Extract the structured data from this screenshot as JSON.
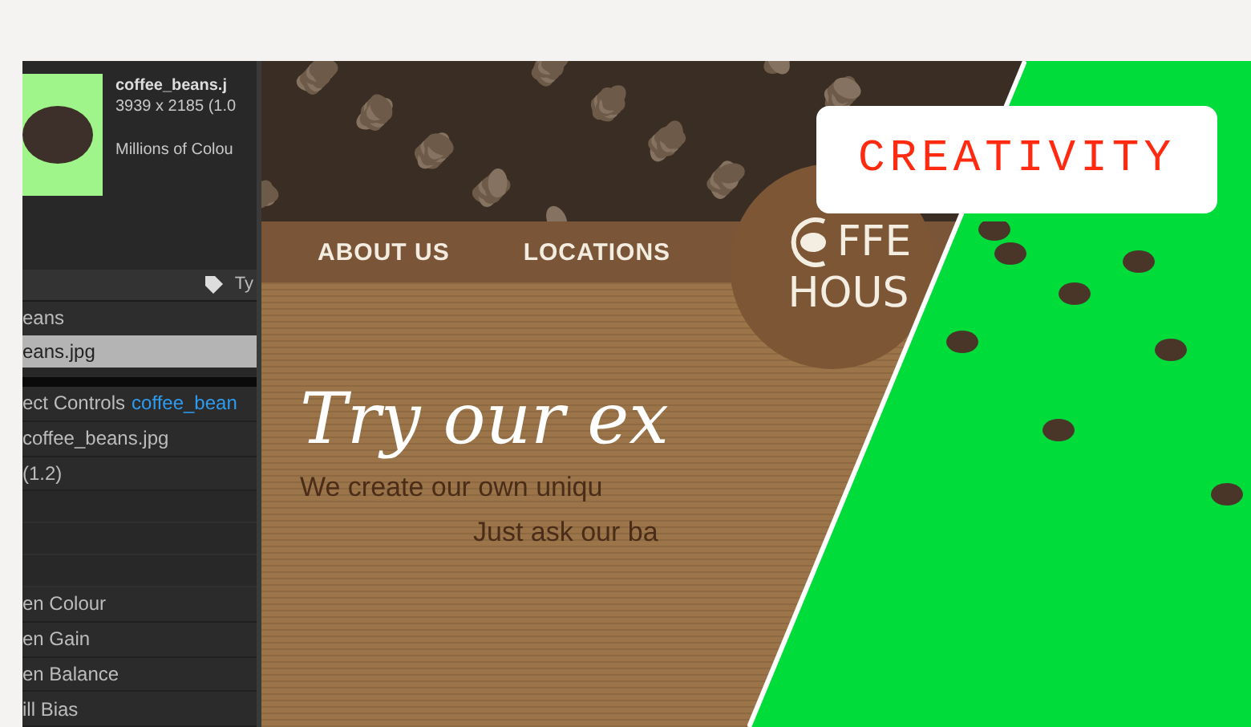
{
  "left_panel": {
    "file_name": "coffee_beans.j",
    "dimensions": "3939 x 2185 (1.0",
    "colour_depth": "Millions of Colou",
    "toolbar_label": "Ty",
    "rows": [
      {
        "label": "eans",
        "selected": false
      },
      {
        "label": "eans.jpg",
        "selected": true
      }
    ],
    "effect_controls": {
      "title": "ect Controls",
      "layer": "coffee_bean"
    },
    "layer_name": "coffee_beans.jpg",
    "version": "(1.2)",
    "properties": [
      "en Colour",
      "en Gain",
      "en Balance",
      "ill Bias"
    ]
  },
  "website": {
    "nav": [
      "ABOUT US",
      "LOCATIONS"
    ],
    "logo": {
      "line_1": "FFE",
      "line_2": "HOUS"
    },
    "headline": "Try our ex",
    "tagline": [
      "We create our own uniqu",
      "Just ask our ba"
    ]
  },
  "badge": "CREATIVITY"
}
